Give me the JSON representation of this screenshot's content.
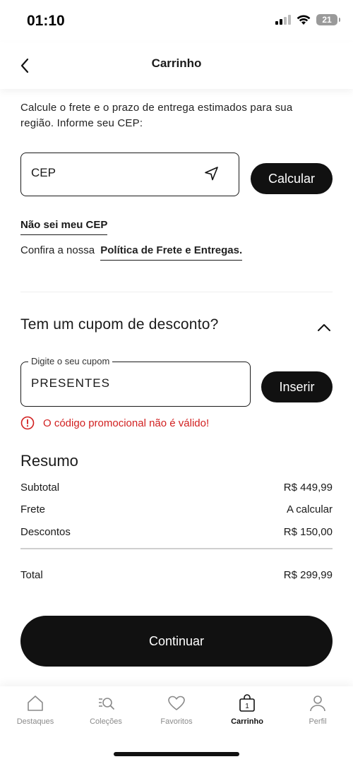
{
  "status": {
    "time": "01:10",
    "battery": "21"
  },
  "header": {
    "title": "Carrinho"
  },
  "shipping": {
    "intro": "Calcule o frete e o prazo de entrega estimados para sua região. Informe seu CEP:",
    "cep_placeholder": "CEP",
    "calculate_label": "Calcular",
    "no_cep_label": "Não sei meu CEP",
    "policy_prefix": "Confira a nossa",
    "policy_link": "Política de Frete e Entregas."
  },
  "coupon": {
    "title": "Tem um cupom de desconto?",
    "field_label": "Digite o seu cupom",
    "value": "PRESENTES",
    "insert_label": "Inserir",
    "error": "O código promocional não é válido!"
  },
  "summary": {
    "title": "Resumo",
    "rows": [
      {
        "label": "Subtotal",
        "value": "R$ 449,99"
      },
      {
        "label": "Frete",
        "value": "A calcular"
      },
      {
        "label": "Descontos",
        "value": "R$ 150,00"
      }
    ],
    "total_label": "Total",
    "total_value": "R$ 299,99"
  },
  "continue_label": "Continuar",
  "tabs": [
    {
      "label": "Destaques",
      "icon": "home-icon"
    },
    {
      "label": "Coleções",
      "icon": "collections-search-icon"
    },
    {
      "label": "Favoritos",
      "icon": "heart-icon"
    },
    {
      "label": "Carrinho",
      "icon": "bag-icon",
      "badge": "1",
      "active": true
    },
    {
      "label": "Perfil",
      "icon": "user-icon"
    }
  ],
  "colors": {
    "accent": "#111111",
    "error": "#d11f1f"
  }
}
